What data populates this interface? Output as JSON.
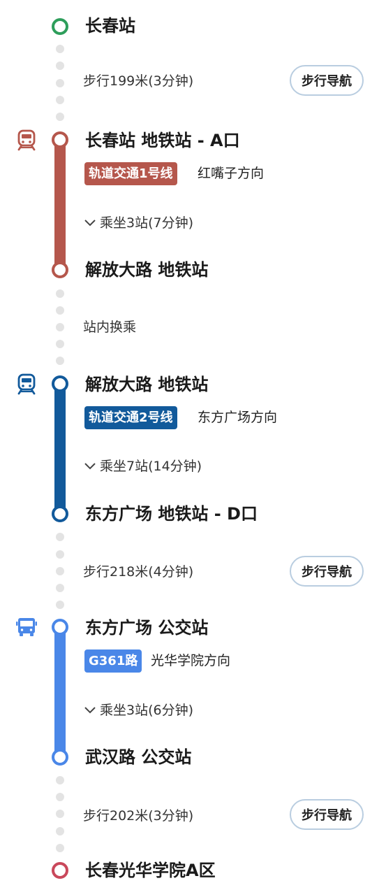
{
  "colors": {
    "line1": "#b5574c",
    "line2": "#125a9b",
    "bus": "#4a87e8",
    "start_node": "#2e9e5b",
    "end_node": "#c9485b",
    "walk_dot": "#e3e3e3"
  },
  "start": {
    "name": "长春站"
  },
  "walk1": {
    "text": "步行199米(3分钟)",
    "button": "步行导航"
  },
  "leg1": {
    "icon": "subway-icon",
    "from": "长春站 地铁站 - A口",
    "line": "轨道交通1号线",
    "direction": "红嘴子方向",
    "ride": "乘坐3站(7分钟)",
    "to": "解放大路 地铁站"
  },
  "transfer": {
    "text": "站内换乘"
  },
  "leg2": {
    "icon": "subway-icon",
    "from": "解放大路 地铁站",
    "line": "轨道交通2号线",
    "direction": "东方广场方向",
    "ride": "乘坐7站(14分钟)",
    "to": "东方广场 地铁站 - D口"
  },
  "walk2": {
    "text": "步行218米(4分钟)",
    "button": "步行导航"
  },
  "leg3": {
    "icon": "bus-icon",
    "from": "东方广场 公交站",
    "line": "G361路",
    "direction": "光华学院方向",
    "ride": "乘坐3站(6分钟)",
    "to": "武汉路 公交站"
  },
  "walk3": {
    "text": "步行202米(3分钟)",
    "button": "步行导航"
  },
  "end": {
    "name": "长春光华学院A区"
  }
}
